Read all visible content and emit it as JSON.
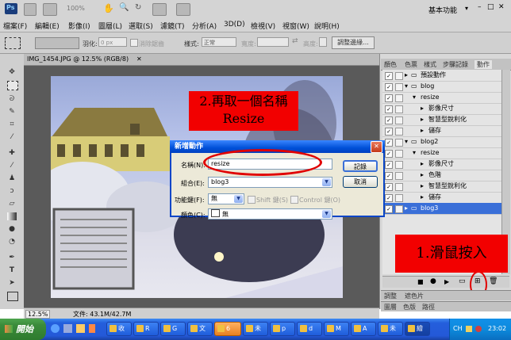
{
  "app": {
    "name": "Ps",
    "zoom_display": "100%",
    "workspace": "基本功能"
  },
  "menu": [
    "檔案(F)",
    "編輯(E)",
    "影像(I)",
    "圖層(L)",
    "選取(S)",
    "濾鏡(T)",
    "分析(A)",
    "3D(D)",
    "檢視(V)",
    "視窗(W)",
    "說明(H)"
  ],
  "options_bar": {
    "feather_label": "羽化:",
    "feather_value": "0 px",
    "antialias_label": "消除鋸齒",
    "style_label": "樣式:",
    "style_value": "正常",
    "width_label": "寬度:",
    "height_label": "高度:",
    "refine_edge_button": "調整邊緣..."
  },
  "document": {
    "tab_title": "IMG_1454.JPG @ 12.5% (RGB/8)",
    "zoom": "12.5%",
    "doc_size": "文件: 43.1M/42.7M"
  },
  "panels": {
    "tabs": [
      "顏色",
      "色票",
      "樣式",
      "步驟記錄",
      "動作"
    ],
    "active_tab": "動作",
    "actions": [
      {
        "level": 0,
        "label": "預設動作",
        "checked": true,
        "type": "folder"
      },
      {
        "level": 0,
        "label": "blog",
        "checked": true,
        "type": "folder"
      },
      {
        "level": 1,
        "label": "resize",
        "checked": true,
        "type": "action"
      },
      {
        "level": 2,
        "label": "影像尺寸",
        "checked": true,
        "type": "step"
      },
      {
        "level": 2,
        "label": "智慧型銳利化",
        "checked": true,
        "type": "step"
      },
      {
        "level": 2,
        "label": "儲存",
        "checked": true,
        "type": "step"
      },
      {
        "level": 0,
        "label": "blog2",
        "checked": true,
        "type": "folder"
      },
      {
        "level": 1,
        "label": "resize",
        "checked": true,
        "type": "action"
      },
      {
        "level": 2,
        "label": "影像尺寸",
        "checked": true,
        "type": "step"
      },
      {
        "level": 2,
        "label": "色階",
        "checked": true,
        "type": "step"
      },
      {
        "level": 2,
        "label": "智慧型銳利化",
        "checked": true,
        "type": "step"
      },
      {
        "level": 2,
        "label": "儲存",
        "checked": true,
        "type": "step"
      },
      {
        "level": 0,
        "label": "blog3",
        "checked": true,
        "type": "folder",
        "selected": true
      }
    ],
    "bottom_tabs_1": [
      "調整",
      "遮色片"
    ],
    "bottom_tabs_2": [
      "圖層",
      "色版",
      "路徑"
    ]
  },
  "dialog": {
    "title": "新增動作",
    "name_label": "名稱(N):",
    "name_value": "resize",
    "set_label": "組合(E):",
    "set_value": "blog3",
    "fkey_label": "功能鍵(F):",
    "fkey_value": "無",
    "shift_label": "Shift 鍵(S)",
    "control_label": "Control 鍵(O)",
    "color_label": "顏色(C):",
    "color_value": "無",
    "record_button": "記錄",
    "cancel_button": "取消"
  },
  "annotations": {
    "note1_line1": "2.再取一個名稱",
    "note1_line2": "Resize",
    "note2": "1.滑鼠按入"
  },
  "taskbar": {
    "start": "開始",
    "tasks": [
      "收",
      "R",
      "G",
      "文",
      "6",
      "未",
      "p",
      "d",
      "M",
      "A",
      "未",
      "繪"
    ],
    "tray_lang": "CH",
    "clock": "23:02"
  }
}
